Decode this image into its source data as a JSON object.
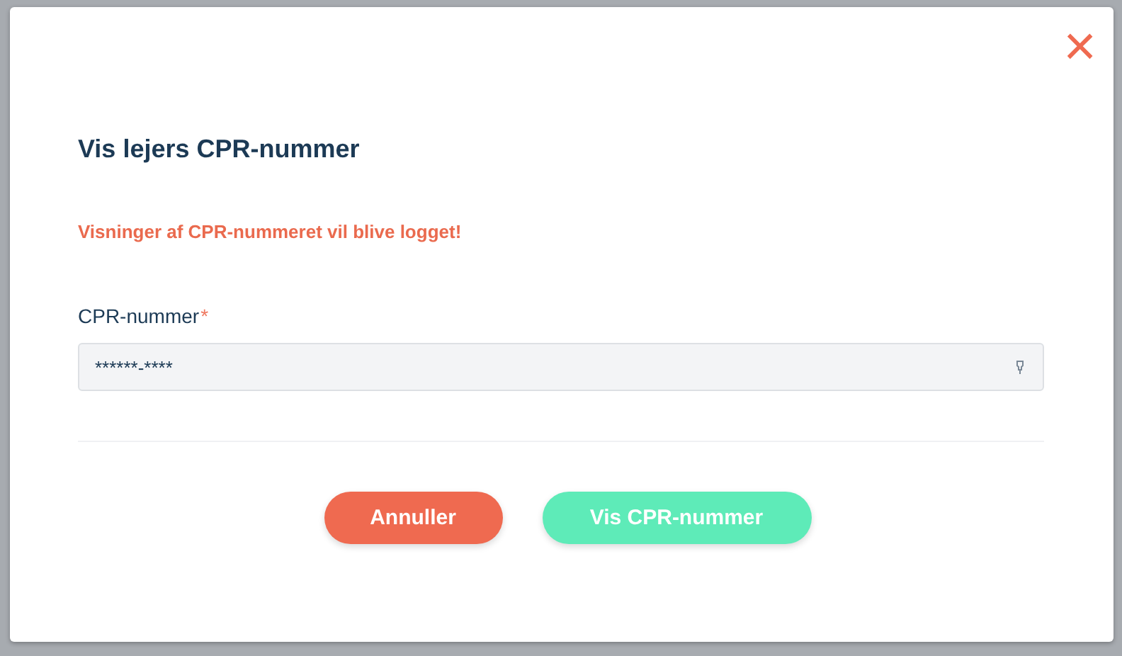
{
  "dialog": {
    "close": "×",
    "title": "Vis lejers CPR-nummer",
    "warning": "Visninger af CPR-nummeret vil blive logget!",
    "field": {
      "label": "CPR-nummer",
      "required_mark": "*",
      "value": "******-****"
    },
    "buttons": [
      {
        "label": "Annuller",
        "kind": "cancel"
      },
      {
        "label": "Vis CPR-nummer",
        "kind": "confirm"
      }
    ]
  }
}
